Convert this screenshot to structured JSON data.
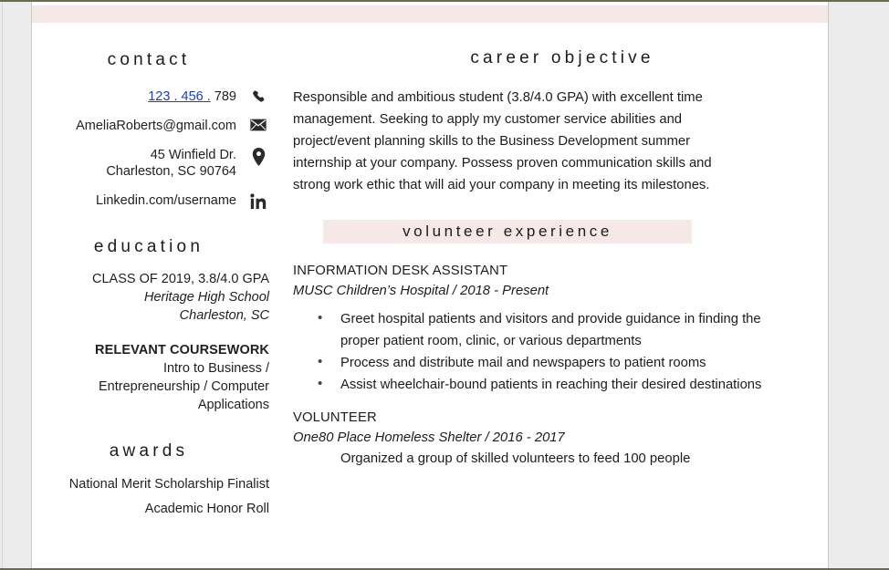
{
  "document": {
    "type": "resume",
    "accent_band_color": "#f5e8e6",
    "page_border_color": "#6b6b4e",
    "gutter_color": "#ececed",
    "link_color": "#1d3fb5"
  },
  "left_column": {
    "contact": {
      "heading": "contact",
      "items": [
        {
          "icon": "phone-icon",
          "linked_part": "123 . 456 .",
          "plain_part": " 789",
          "full_text": "123 . 456 . 789"
        },
        {
          "icon": "envelope-icon",
          "full_text": "AmeliaRoberts@gmail.com"
        },
        {
          "icon": "map-pin-icon",
          "line1": "45 Winfield Dr.",
          "line2": "Charleston, SC 90764",
          "full_text": "45 Winfield Dr. Charleston, SC 90764"
        },
        {
          "icon": "linkedin-icon",
          "full_text": "Linkedin.com/username"
        }
      ]
    },
    "education": {
      "heading": "education",
      "class_line": "CLASS OF 2019, 3.8/4.0 GPA",
      "school": "Heritage High School",
      "location": "Charleston, SC",
      "coursework_heading": "RELEVANT COURSEWORK",
      "coursework_line1": "Intro to Business /",
      "coursework_line2": "Entrepreneurship / Computer",
      "coursework_line3": "Applications"
    },
    "awards": {
      "heading": "awards",
      "items": [
        "National Merit Scholarship Finalist",
        "Academic Honor Roll"
      ]
    }
  },
  "right_column": {
    "objective": {
      "heading": "career objective",
      "body": "Responsible and ambitious student (3.8/4.0 GPA) with excellent time management. Seeking to apply my customer service abilities and project/event planning skills to the Business Development summer internship at your company. Possess proven communication skills and strong work ethic that will aid your company in meeting its milestones."
    },
    "volunteer": {
      "heading": "volunteer experience",
      "entries": [
        {
          "title": "INFORMATION DESK ASSISTANT",
          "meta": "MUSC Children’s Hospital / 2018 - Present",
          "bullets": [
            "Greet hospital patients and visitors and provide guidance in finding the proper patient room, clinic, or various departments",
            "Process and distribute mail and newspapers to patient rooms",
            "Assist wheelchair-bound patients in reaching their desired destinations"
          ]
        },
        {
          "title": "VOLUNTEER",
          "meta": "One80 Place Homeless Shelter / 2016 - 2017",
          "clipped_bullet": "Organized a group of skilled volunteers to feed 100 people"
        }
      ]
    }
  }
}
